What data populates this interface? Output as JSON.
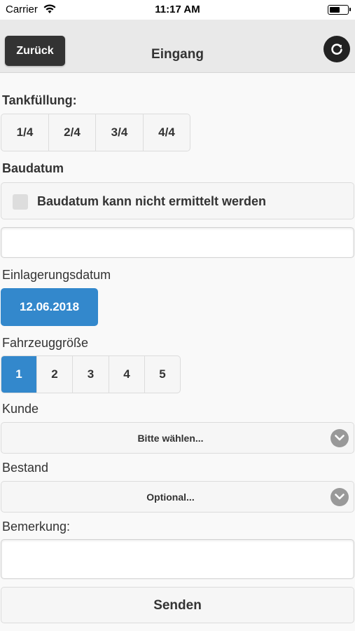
{
  "status_bar": {
    "carrier": "Carrier",
    "time": "11:17 AM",
    "wifi_icon": "wifi-icon",
    "battery_icon": "battery-icon"
  },
  "header": {
    "back_label": "Zurück",
    "title": "Eingang",
    "refresh_icon": "refresh-icon"
  },
  "tank": {
    "label": "Tankfüllung:",
    "options": [
      "1/4",
      "2/4",
      "3/4",
      "4/4"
    ]
  },
  "baudatum": {
    "label": "Baudatum",
    "checkbox_label": "Baudatum kann nicht ermittelt werden",
    "checked": false,
    "value": ""
  },
  "einlagerung": {
    "label": "Einlagerungsdatum",
    "date": "12.06.2018"
  },
  "fahrzeug": {
    "label": "Fahrzeuggröße",
    "options": [
      "1",
      "2",
      "3",
      "4",
      "5"
    ],
    "selected": "1"
  },
  "kunde": {
    "label": "Kunde",
    "selected_text": "Bitte wählen..."
  },
  "bestand": {
    "label": "Bestand",
    "selected_text": "Optional..."
  },
  "bemerkung": {
    "label": "Bemerkung:",
    "value": ""
  },
  "send_label": "Senden",
  "colors": {
    "accent": "#3388cc",
    "header_bg": "#e9e9e9",
    "dark_button": "#333333"
  }
}
